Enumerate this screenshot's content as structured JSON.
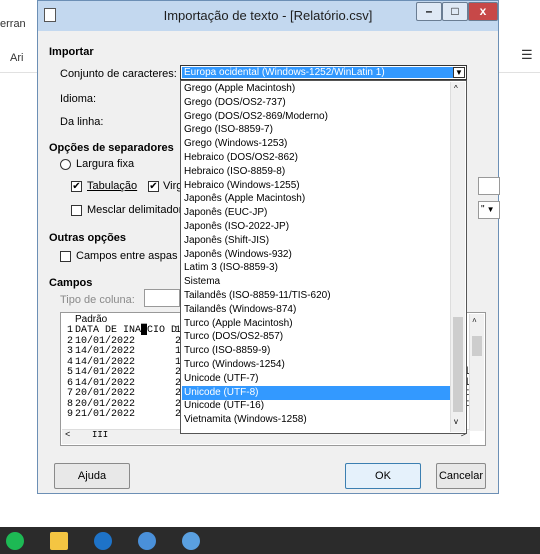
{
  "background": {
    "left_tab_1": "erran",
    "left_tab_2": "Ari",
    "right_icon": "list-icon"
  },
  "dialog": {
    "title": "Importação de texto - [Relatório.csv]",
    "window_icon": "document-icon",
    "minimize_glyph": "–",
    "maximize_glyph": "□",
    "close_glyph": "x",
    "importar": {
      "heading": "Importar",
      "charset_label": "Conjunto de caracteres:",
      "charset_value": "Europa ocidental (Windows-1252/WinLatin 1)",
      "idioma_label": "Idioma:",
      "da_linha_label": "Da linha:"
    },
    "separadores": {
      "heading": "Opções de separadores",
      "largura_fixa": "Largura fixa",
      "tabulacao": "Tabulação",
      "virgula": "Virg",
      "mesclar": "Mesclar delimitadore",
      "quote_value": "\""
    },
    "outras": {
      "heading": "Outras opções",
      "campos_aspas": "Campos entre aspas co"
    },
    "campos": {
      "heading": "Campos",
      "tipo_coluna_label": "Tipo de coluna:",
      "column_header": "Padrão",
      "column_header_2": "P",
      "rows": [
        {
          "n": "1",
          "text": "DATA DE INA█CIO D"
        },
        {
          "n": "2",
          "text": "10/01/2022"
        },
        {
          "n": "3",
          "text": "14/01/2022"
        },
        {
          "n": "4",
          "text": "14/01/2022"
        },
        {
          "n": "5",
          "text": "14/01/2022"
        },
        {
          "n": "6",
          "text": "14/01/2022"
        },
        {
          "n": "7",
          "text": "20/01/2022"
        },
        {
          "n": "8",
          "text": "20/01/2022"
        },
        {
          "n": "9",
          "text": "21/01/2022"
        }
      ],
      "row_second_col": [
        "1",
        "2",
        "1",
        "1",
        "2",
        "2",
        "2",
        "2",
        "2"
      ],
      "right_text": [
        "tial",
        "tial",
        "reat",
        "reat"
      ],
      "h_scroll_thumb": "III"
    },
    "buttons": {
      "ajuda": "Ajuda",
      "ok": "OK",
      "cancelar": "Cancelar"
    },
    "dropdown_items": [
      "Grego (Apple Macintosh)",
      "Grego (DOS/OS2-737)",
      "Grego (DOS/OS2-869/Moderno)",
      "Grego (ISO-8859-7)",
      "Grego (Windows-1253)",
      "Hebraico (DOS/OS2-862)",
      "Hebraico (ISO-8859-8)",
      "Hebraico (Windows-1255)",
      "Japonês (Apple Macintosh)",
      "Japonês (EUC-JP)",
      "Japonês (ISO-2022-JP)",
      "Japonês (Shift-JIS)",
      "Japonês (Windows-932)",
      "Latim 3 (ISO-8859-3)",
      "Sistema",
      "Tailandês (ISO-8859-11/TIS-620)",
      "Tailandês (Windows-874)",
      "Turco (Apple Macintosh)",
      "Turco (DOS/OS2-857)",
      "Turco (ISO-8859-9)",
      "Turco (Windows-1254)",
      "Unicode (UTF-7)",
      "Unicode (UTF-8)",
      "Unicode (UTF-16)",
      "Vietnamita (Windows-1258)"
    ],
    "dropdown_selected": "Unicode (UTF-8)"
  },
  "taskbar": {
    "icons": [
      "spotify-icon",
      "file-explorer-icon",
      "edge-icon",
      "chrome-icon",
      "chrome-alt-icon"
    ]
  },
  "colors": {
    "selection": "#3399ff",
    "titlebar": "#c3d8ef",
    "close_button": "#c74848",
    "taskbar": "#2b2b2b"
  }
}
